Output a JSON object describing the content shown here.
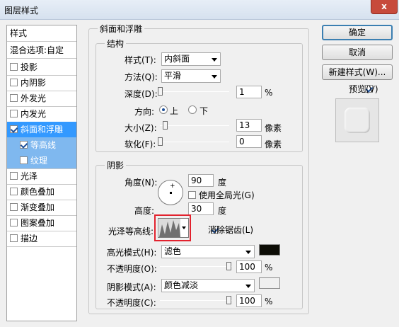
{
  "window": {
    "title": "图层样式",
    "close_glyph": "x"
  },
  "styles_panel": {
    "header": "样式",
    "blend_options": "混合选项:自定",
    "items": [
      {
        "label": "投影",
        "checked": false
      },
      {
        "label": "内阴影",
        "checked": false
      },
      {
        "label": "外发光",
        "checked": false
      },
      {
        "label": "内发光",
        "checked": false
      },
      {
        "label": "斜面和浮雕",
        "checked": true,
        "selected": true
      },
      {
        "label": "等高线",
        "checked": true,
        "sub": true
      },
      {
        "label": "纹理",
        "checked": false,
        "sub": true
      },
      {
        "label": "光泽",
        "checked": false
      },
      {
        "label": "颜色叠加",
        "checked": false
      },
      {
        "label": "渐变叠加",
        "checked": false
      },
      {
        "label": "图案叠加",
        "checked": false
      },
      {
        "label": "描边",
        "checked": false
      }
    ]
  },
  "bevel": {
    "title": "斜面和浮雕",
    "structure": {
      "title": "结构",
      "style_label": "样式(T):",
      "style_value": "内斜面",
      "technique_label": "方法(Q):",
      "technique_value": "平滑",
      "depth_label": "深度(D):",
      "depth_value": "1",
      "depth_unit": "%",
      "depth_slider": 0.0,
      "direction_label": "方向:",
      "direction_up": "上",
      "direction_down": "下",
      "size_label": "大小(Z):",
      "size_value": "13",
      "size_unit": "像素",
      "size_slider": 0.07,
      "soften_label": "软化(F):",
      "soften_value": "0",
      "soften_unit": "像素",
      "soften_slider": 0.0
    },
    "shading": {
      "title": "阴影",
      "angle_label": "角度(N):",
      "angle_value": "90",
      "angle_unit": "度",
      "global_light_label": "使用全局光(G)",
      "altitude_label": "高度:",
      "altitude_value": "30",
      "altitude_unit": "度",
      "gloss_contour_label": "光泽等高线:",
      "antialias_label": "消除锯齿(L)",
      "highlight_mode_label": "高光模式(H):",
      "highlight_mode_value": "滤色",
      "highlight_color": "#0d0d06",
      "highlight_opacity_label": "不透明度(O):",
      "highlight_opacity_value": "100",
      "highlight_opacity_unit": "%",
      "shadow_mode_label": "阴影模式(A):",
      "shadow_mode_value": "颜色减淡",
      "shadow_color": "#f0f0f0",
      "shadow_opacity_label": "不透明度(C):",
      "shadow_opacity_value": "100",
      "shadow_opacity_unit": "%"
    }
  },
  "buttons": {
    "ok": "确定",
    "cancel": "取消",
    "new_style": "新建样式(W)...",
    "preview_label": "预览(V)"
  },
  "colors": {
    "selection": "#3399ff",
    "highlight_box": "#e2222e"
  }
}
